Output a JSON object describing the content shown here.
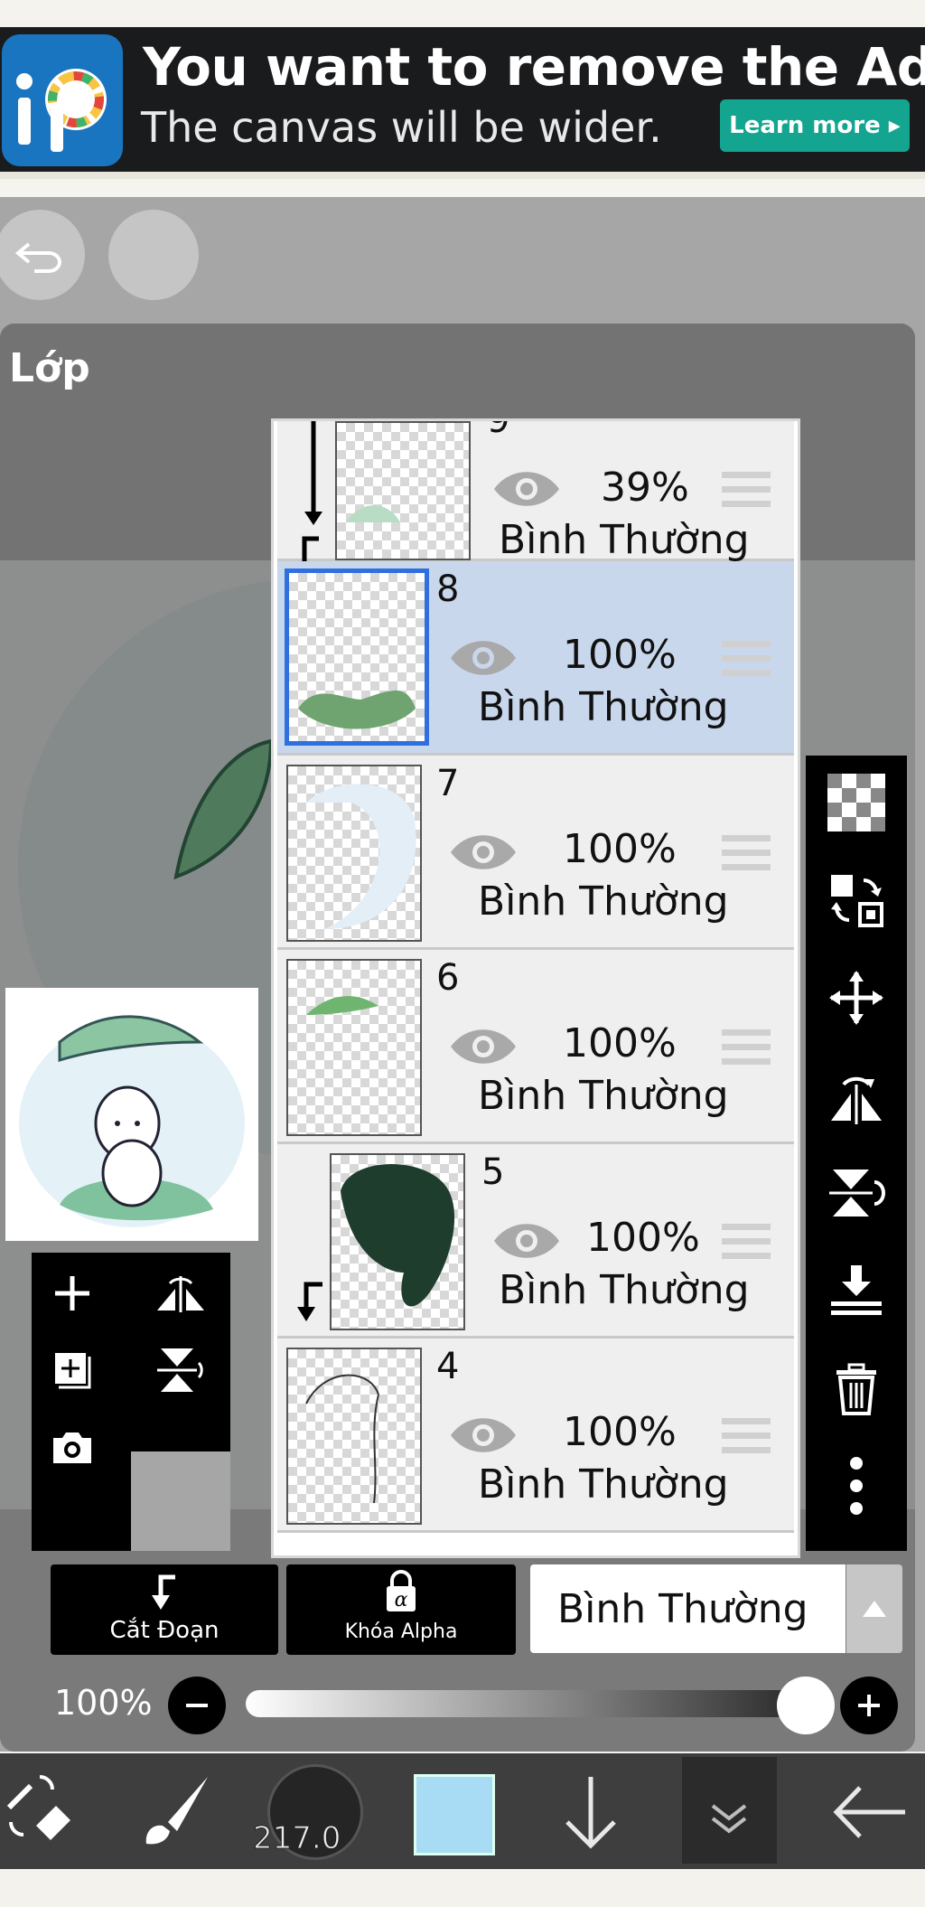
{
  "ad": {
    "title": "You want to remove the Ad?",
    "subtitle": "The canvas will be wider.",
    "cta": "Learn more ▸"
  },
  "panel": {
    "title": "Lớp"
  },
  "layers": [
    {
      "number": "9",
      "opacity": "39%",
      "blend": "Bình Thường",
      "clipped": true,
      "selected": false
    },
    {
      "number": "8",
      "opacity": "100%",
      "blend": "Bình Thường",
      "clipped": false,
      "selected": true
    },
    {
      "number": "7",
      "opacity": "100%",
      "blend": "Bình Thường",
      "clipped": false,
      "selected": false
    },
    {
      "number": "6",
      "opacity": "100%",
      "blend": "Bình Thường",
      "clipped": false,
      "selected": false
    },
    {
      "number": "5",
      "opacity": "100%",
      "blend": "Bình Thường",
      "clipped": true,
      "selected": false
    },
    {
      "number": "4",
      "opacity": "100%",
      "blend": "Bình Thường",
      "clipped": false,
      "selected": false
    }
  ],
  "controls": {
    "clip_label": "Cắt Đoạn",
    "alpha_lock_label": "Khóa Alpha",
    "blend_mode": "Bình Thường",
    "opacity_label": "100%",
    "opacity_value": 1.0
  },
  "toolbar": {
    "brush_size": "217.0",
    "color": "#a8dcf5"
  },
  "icons": {
    "undo": "undo-icon",
    "redo": "redo-icon",
    "visibility": "eye-icon",
    "drag": "drag-handle-icon"
  }
}
